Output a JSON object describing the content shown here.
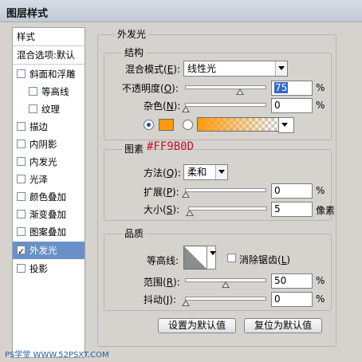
{
  "window": {
    "title": "图层样式"
  },
  "left_panel": {
    "header": "样式",
    "blend_default": "混合选项:默认",
    "items": [
      {
        "label": "斜面和浮雕",
        "checked": false,
        "selected": false
      },
      {
        "label": "等高线",
        "checked": false,
        "selected": false
      },
      {
        "label": "纹理",
        "checked": false,
        "selected": false
      },
      {
        "label": "描边",
        "checked": false,
        "selected": false
      },
      {
        "label": "内阴影",
        "checked": false,
        "selected": false
      },
      {
        "label": "内发光",
        "checked": false,
        "selected": false
      },
      {
        "label": "光泽",
        "checked": false,
        "selected": false
      },
      {
        "label": "颜色叠加",
        "checked": false,
        "selected": false
      },
      {
        "label": "渐变叠加",
        "checked": false,
        "selected": false
      },
      {
        "label": "图案叠加",
        "checked": false,
        "selected": false
      },
      {
        "label": "外发光",
        "checked": true,
        "selected": true
      },
      {
        "label": "投影",
        "checked": false,
        "selected": false
      }
    ]
  },
  "outer_glow": {
    "title": "外发光",
    "structure": {
      "title": "结构",
      "blend_mode_label": "混合模式(",
      "blend_mode_key": "E",
      "blend_mode_value": "线性光",
      "opacity_label": "不透明度(",
      "opacity_key": "O",
      "opacity_value": "75",
      "opacity_unit": "%",
      "noise_label": "杂色(",
      "noise_key": "N",
      "noise_value": "0",
      "noise_unit": "%",
      "color_hex": "#FF9B0D",
      "color_mode": "solid"
    },
    "elements": {
      "title": "图素",
      "technique_label": "方法(",
      "technique_key": "Q",
      "technique_value": "柔和",
      "spread_label": "扩展(",
      "spread_key": "P",
      "spread_value": "0",
      "spread_unit": "%",
      "size_label": "大小(",
      "size_key": "S",
      "size_value": "5",
      "size_unit": "像素"
    },
    "quality": {
      "title": "品质",
      "contour_label": "等高线:",
      "anti_alias_label": "消除锯齿(",
      "anti_alias_key": "L",
      "anti_alias_checked": false,
      "range_label": "范围(",
      "range_key": "R",
      "range_value": "50",
      "range_unit": "%",
      "jitter_label": "抖动(",
      "jitter_key": "J",
      "jitter_value": "0",
      "jitter_unit": "%"
    },
    "buttons": {
      "make_default": "设置为默认值",
      "reset_default": "复位为默认值"
    }
  },
  "annotation": "#FF9B0D",
  "watermark": "PS学堂 WWW.52PSXT.COM"
}
